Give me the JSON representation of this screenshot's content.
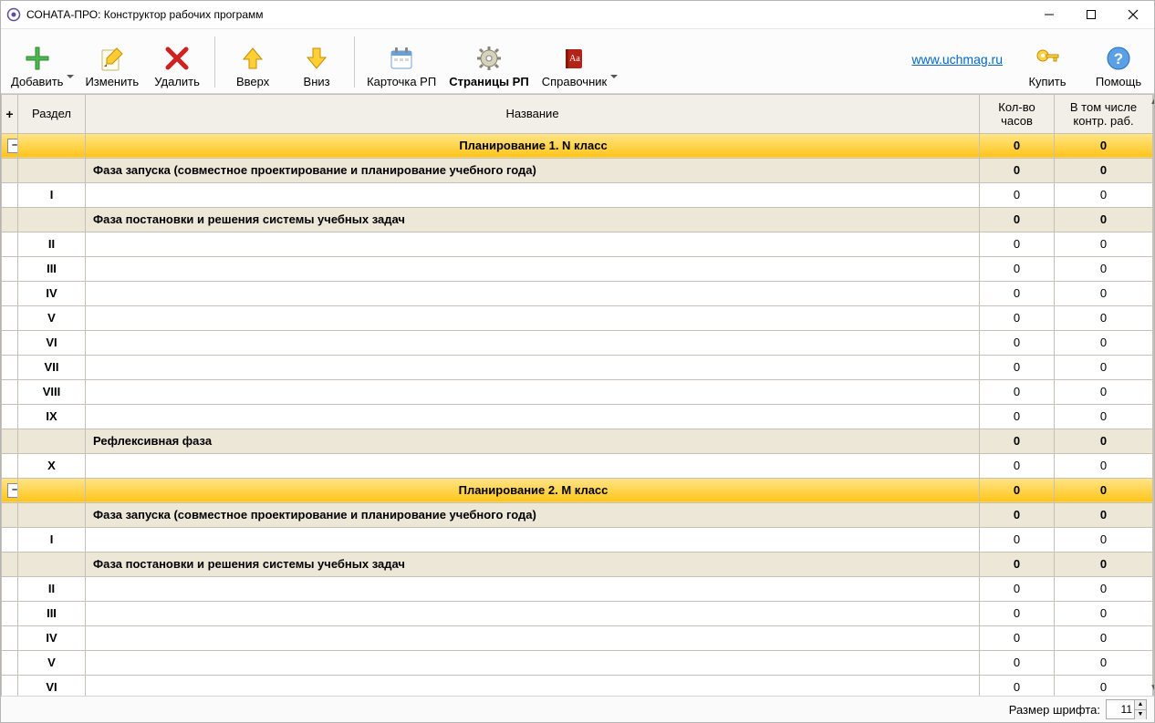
{
  "window": {
    "title": "СОНАТА-ПРО: Конструктор рабочих программ"
  },
  "toolbar": {
    "add": "Добавить",
    "edit": "Изменить",
    "delete": "Удалить",
    "up": "Вверх",
    "down": "Вниз",
    "card": "Карточка РП",
    "pages": "Страницы РП",
    "ref": "Справочник",
    "buy": "Купить",
    "help": "Помощь",
    "link": "www.uchmag.ru"
  },
  "grid": {
    "plus": "+",
    "col_section": "Раздел",
    "col_name": "Название",
    "col_hours": "Кол-во часов",
    "col_ctrl": "В том числе контр. раб.",
    "rows": [
      {
        "type": "plan",
        "toggle": "–",
        "name": "Планирование 1. N класс",
        "hours": "0",
        "ctrl": "0"
      },
      {
        "type": "phase",
        "name": "Фаза запуска (совместное проектирование и  планирование учебного года)",
        "hours": "0",
        "ctrl": "0"
      },
      {
        "type": "item",
        "section": "I",
        "name": "",
        "hours": "0",
        "ctrl": "0"
      },
      {
        "type": "phase",
        "name": "Фаза постановки и решения системы учебных задач",
        "hours": "0",
        "ctrl": "0"
      },
      {
        "type": "item",
        "section": "II",
        "name": "",
        "hours": "0",
        "ctrl": "0"
      },
      {
        "type": "item",
        "section": "III",
        "name": "",
        "hours": "0",
        "ctrl": "0"
      },
      {
        "type": "item",
        "section": "IV",
        "name": "",
        "hours": "0",
        "ctrl": "0"
      },
      {
        "type": "item",
        "section": "V",
        "name": "",
        "hours": "0",
        "ctrl": "0"
      },
      {
        "type": "item",
        "section": "VI",
        "name": "",
        "hours": "0",
        "ctrl": "0"
      },
      {
        "type": "item",
        "section": "VII",
        "name": "",
        "hours": "0",
        "ctrl": "0"
      },
      {
        "type": "item",
        "section": "VIII",
        "name": "",
        "hours": "0",
        "ctrl": "0"
      },
      {
        "type": "item",
        "section": "IX",
        "name": "",
        "hours": "0",
        "ctrl": "0"
      },
      {
        "type": "phase",
        "name": "Рефлексивная фаза",
        "hours": "0",
        "ctrl": "0"
      },
      {
        "type": "item",
        "section": "X",
        "name": "",
        "hours": "0",
        "ctrl": "0"
      },
      {
        "type": "plan",
        "toggle": "–",
        "name": "Планирование 2. M класс",
        "hours": "0",
        "ctrl": "0"
      },
      {
        "type": "phase",
        "name": "Фаза запуска (совместное проектирование и  планирование учебного года)",
        "hours": "0",
        "ctrl": "0"
      },
      {
        "type": "item",
        "section": "I",
        "name": "",
        "hours": "0",
        "ctrl": "0"
      },
      {
        "type": "phase",
        "name": "Фаза постановки и решения системы учебных задач",
        "hours": "0",
        "ctrl": "0"
      },
      {
        "type": "item",
        "section": "II",
        "name": "",
        "hours": "0",
        "ctrl": "0"
      },
      {
        "type": "item",
        "section": "III",
        "name": "",
        "hours": "0",
        "ctrl": "0"
      },
      {
        "type": "item",
        "section": "IV",
        "name": "",
        "hours": "0",
        "ctrl": "0"
      },
      {
        "type": "item",
        "section": "V",
        "name": "",
        "hours": "0",
        "ctrl": "0"
      },
      {
        "type": "item",
        "section": "VI",
        "name": "",
        "hours": "0",
        "ctrl": "0"
      }
    ]
  },
  "status": {
    "label": "Размер шрифта:",
    "value": "11"
  }
}
